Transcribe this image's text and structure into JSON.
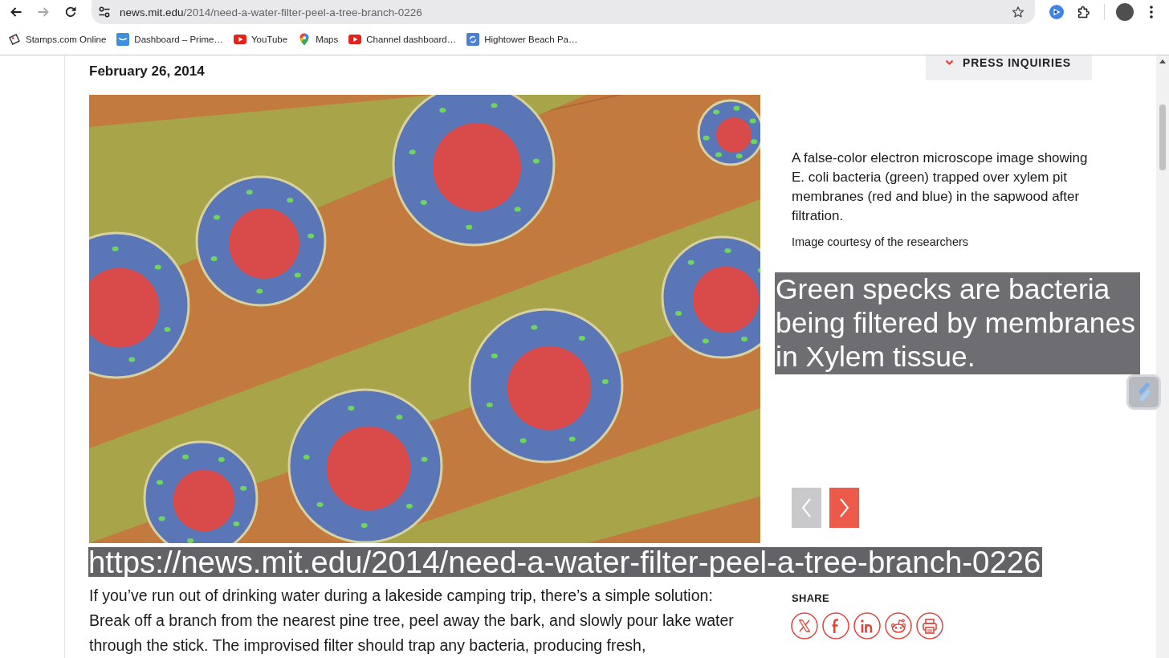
{
  "browser": {
    "nav_buttons": [
      {
        "kind": "back",
        "disabled": false
      },
      {
        "kind": "forward",
        "disabled": true
      },
      {
        "kind": "reload",
        "disabled": false
      }
    ],
    "address_bar": {
      "domain": "news.mit.edu",
      "path": "/2014/need-a-water-filter-peel-a-tree-branch-0226"
    },
    "bookmarks": [
      {
        "label": "Stamps.com Online",
        "kind": "tag"
      },
      {
        "label": "Dashboard – Prime…",
        "kind": "smile-tile"
      },
      {
        "label": "YouTube",
        "kind": "video"
      },
      {
        "label": "Maps",
        "kind": "pin"
      },
      {
        "label": "Channel dashboard…",
        "kind": "video"
      },
      {
        "label": "Hightower Beach Pa…",
        "kind": "arrows-tile"
      }
    ]
  },
  "article": {
    "date": "February 26, 2014",
    "press_button": {
      "label": "PRESS INQUIRIES",
      "expanded": false
    },
    "media": {
      "caption_lines": [
        "A false-color electron microscope image showing",
        "E. coli bacteria (green) trapped over xylem pit",
        "membranes (red and blue) in the sapwood after",
        "filtration."
      ],
      "credit": "Image courtesy of the researchers",
      "annotation": "Green specks are bacteria being filtered by membranes in Xylem tissue.",
      "carousel": {
        "prev": {
          "disabled": true
        },
        "next": {
          "disabled": false
        }
      }
    },
    "url_overlay": "https://news.mit.edu/2014/need-a-water-filter-peel-a-tree-branch-0226",
    "body_lines": [
      "If you’ve run out of drinking water during a lakeside camping trip, there’s a simple solution:",
      "Break off a branch from the nearest pine tree, peel away the bark, and slowly pour lake water",
      "through the stick. The improvised filter should trap any bacteria, producing fresh,"
    ],
    "share": {
      "label": "SHARE"
    }
  }
}
